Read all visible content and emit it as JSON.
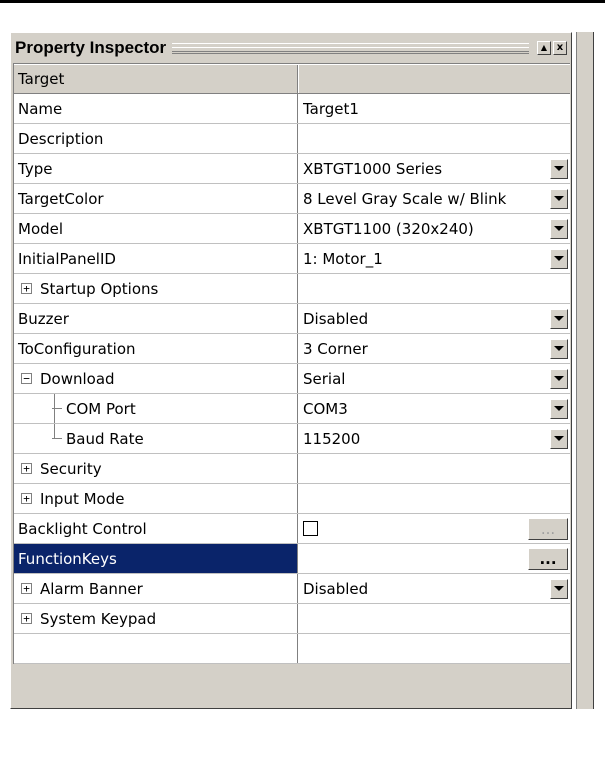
{
  "panel": {
    "title": "Property Inspector",
    "minimize_glyph": "▲",
    "close_glyph": "x"
  },
  "header": {
    "name_col": "Target",
    "value_col": ""
  },
  "rows": [
    {
      "label": "Name",
      "value": "Target1"
    },
    {
      "label": "Description",
      "value": ""
    },
    {
      "label": "Type",
      "value": "XBTGT1000 Series"
    },
    {
      "label": "TargetColor",
      "value": "8 Level Gray Scale w/ Blink"
    },
    {
      "label": "Model",
      "value": "XBTGT1100 (320x240)"
    },
    {
      "label": "InitialPanelID",
      "value": "1: Motor_1"
    },
    {
      "label": "Startup Options",
      "value": "",
      "expander": "+"
    },
    {
      "label": "Buzzer",
      "value": "Disabled"
    },
    {
      "label": "ToConfiguration",
      "value": "3 Corner"
    },
    {
      "label": "Download",
      "value": "Serial",
      "expander": "−"
    },
    {
      "label": "COM Port",
      "value": "COM3"
    },
    {
      "label": "Baud Rate",
      "value": "115200"
    },
    {
      "label": "Security",
      "value": "",
      "expander": "+"
    },
    {
      "label": "Input Mode",
      "value": "",
      "expander": "+"
    },
    {
      "label": "Backlight Control",
      "value": ""
    },
    {
      "label": "FunctionKeys",
      "value": ""
    },
    {
      "label": "Alarm Banner",
      "value": "Disabled",
      "expander": "+"
    },
    {
      "label": "System Keypad",
      "value": "",
      "expander": "+"
    },
    {
      "label": "",
      "value": ""
    }
  ],
  "ellipsis_label": "...",
  "colors": {
    "selection": "#0a246a",
    "face": "#d4d0c8"
  }
}
